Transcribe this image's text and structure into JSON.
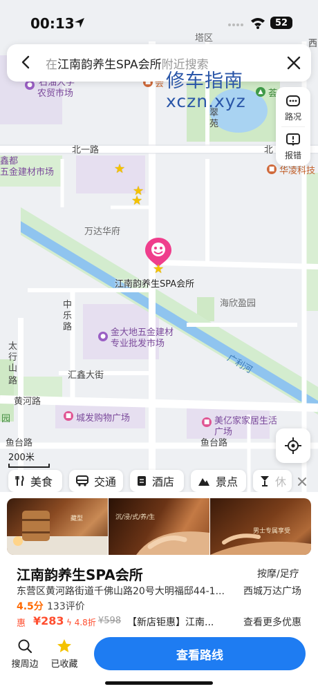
{
  "status": {
    "time": "00:13",
    "battery": "52"
  },
  "search": {
    "back_label": "返回",
    "prefix": "在",
    "place": "江南韵养生SPA会所",
    "suffix": "附近搜索"
  },
  "watermark": {
    "line1": "修车指南",
    "line2": "xczn.xyz"
  },
  "tools": {
    "traffic": "路况",
    "report": "报错"
  },
  "map_labels": {
    "tower_area": "塔区",
    "farm_market": "农贸市场",
    "stone_oil_univ": "石油大学",
    "north_rd_1": "北一路",
    "north_rd_1_right": "北",
    "xindu": "鑫都",
    "hardware_market": "五金建材市场",
    "hualing": "华凌科技",
    "wanda_huafu": "万达华府",
    "haixin_yingyuan": "海欣盈园",
    "zhongle_rd_1": "中",
    "zhongle_rd_2": "乐",
    "zhongle_rd_3": "路",
    "jindadi_1": "金大地五金建材",
    "jindadi_2": "专业批发市场",
    "taihang_1": "太",
    "taihang_2": "行",
    "taihang_3": "山",
    "taihang_4": "路",
    "huixin_st": "汇鑫大街",
    "huanghe_rd": "黄河路",
    "chengfa_mall": "城发购物广场",
    "meiyi_1": "美亿家家居生活",
    "meiyi_2": "广场",
    "yutai_rd_left": "鱼台路",
    "yutai_rd_right": "鱼台路",
    "yuan": "园",
    "xi": "西",
    "cui": "翠",
    "yuan2": "苑",
    "hui": "荟",
    "river": "广利河",
    "hui2": "会"
  },
  "scale": "200米",
  "pin_label": "江南韵养生SPA会所",
  "chips": [
    "美食",
    "交通",
    "酒店",
    "景点",
    "休"
  ],
  "photos": [
    {
      "caption": "藏型"
    },
    {
      "caption": "沉/浸/式/养/生"
    },
    {
      "caption": "男士专属享受"
    }
  ],
  "shop": {
    "name": "江南韵养生SPA会所",
    "category": "按摩/足疗",
    "address": "东营区黄河路街道千佛山路20号大明福邸44-1...",
    "area": "西城万达广场",
    "rating": "4.5分",
    "reviews": "133评价"
  },
  "deal": {
    "badge": "惠",
    "price": "¥283",
    "discount": "4.8折",
    "original": "¥598",
    "title": "【新店钜惠】江南...",
    "more": "查看更多优惠"
  },
  "bottom": {
    "nearby": "搜周边",
    "saved": "已收藏",
    "route": "查看路线"
  },
  "colors": {
    "accent": "#1e7cf2",
    "pin": "#ef3e8c",
    "river": "#8fc4ef",
    "price": "#ff4d2e",
    "rating": "#ff6a00",
    "star": "#f4c200"
  }
}
